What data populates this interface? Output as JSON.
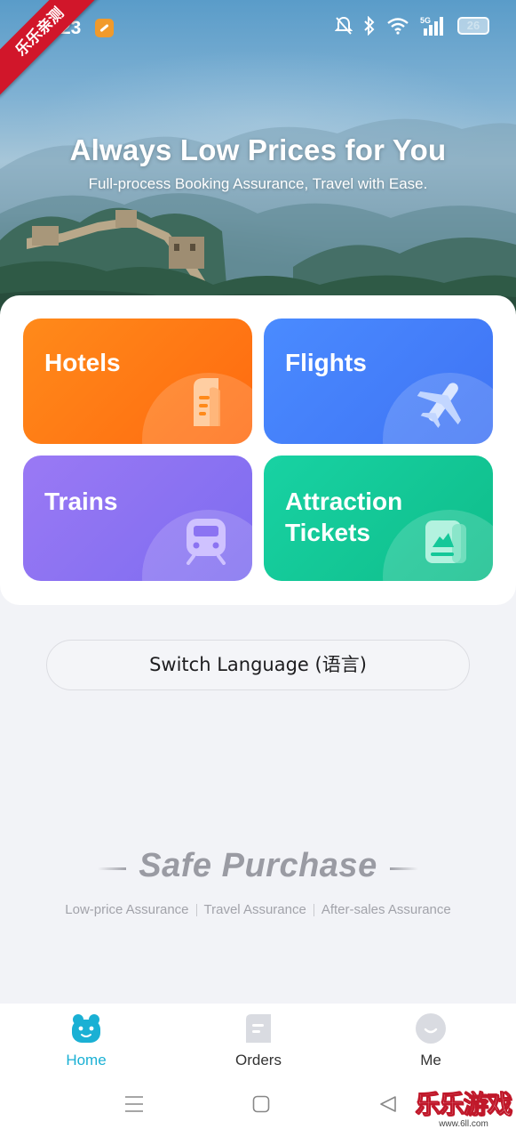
{
  "status_bar": {
    "time": "23",
    "battery": "26",
    "network": "5G"
  },
  "corner_ribbon": "乐乐亲测",
  "hero": {
    "title": "Always Low Prices for You",
    "subtitle": "Full-process Booking Assurance, Travel with Ease."
  },
  "services": [
    {
      "label": "Hotels",
      "icon": "hotel-icon",
      "color": "#ff7a14"
    },
    {
      "label": "Flights",
      "icon": "plane-icon",
      "color": "#4480fa"
    },
    {
      "label": "Trains",
      "icon": "train-icon",
      "color": "#8b73f2"
    },
    {
      "label": "Attraction\nTickets",
      "icon": "ticket-icon",
      "color": "#14c899"
    }
  ],
  "language_button": "Switch Language (语言)",
  "safe_purchase": {
    "title": "Safe Purchase",
    "items": [
      "Low-price Assurance",
      "Travel Assurance",
      "After-sales Assurance"
    ]
  },
  "tabs": [
    {
      "label": "Home",
      "icon": "home-mascot-icon",
      "active": true,
      "color": "#1ab0d4"
    },
    {
      "label": "Orders",
      "icon": "orders-icon",
      "active": false
    },
    {
      "label": "Me",
      "icon": "profile-icon",
      "active": false
    }
  ],
  "system_nav": [
    "menu-icon",
    "home-square-icon",
    "back-triangle-icon"
  ],
  "watermark": {
    "text": "乐乐游戏",
    "url": "www.6ll.com"
  }
}
